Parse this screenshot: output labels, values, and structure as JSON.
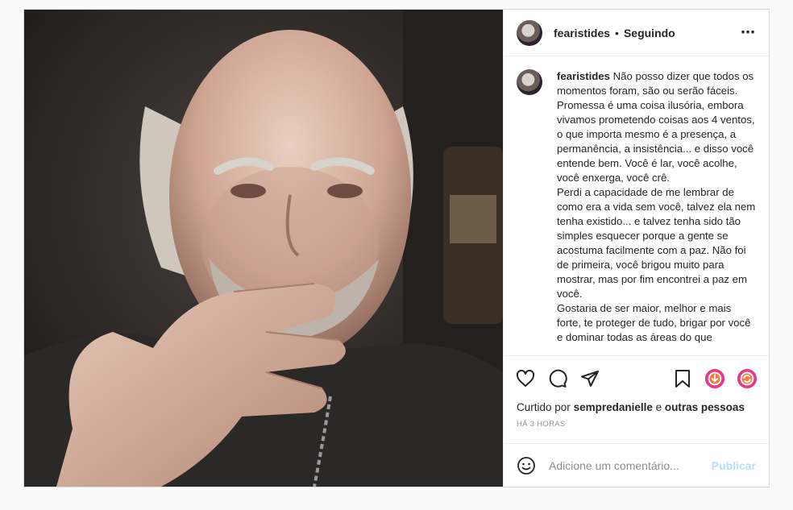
{
  "post": {
    "username": "fearistides",
    "separator": "•",
    "follow_status": "Seguindo",
    "more_icon": "⋯",
    "caption": {
      "username": "fearistides",
      "paragraphs": [
        "Não posso dizer que todos os momentos foram, são ou serão fáceis. Promessa é uma coisa ilusória, embora vivamos prometendo coisas aos 4 ventos, o que importa mesmo é a presença, a permanência, a insistência... e disso você entende bem. Você é lar, você acolhe, você enxerga, você crê.",
        "Perdi a capacidade de me lembrar de como era a vida sem você, talvez ela nem tenha existido... e talvez tenha sido tão simples esquecer porque a gente se acostuma facilmente com a paz. Não foi de primeira, você brigou muito para mostrar, mas por fim encontrei a paz em você.",
        "Gostaria de ser maior, melhor e mais forte, te proteger de tudo, brigar por você e dominar todas as áreas do que"
      ]
    },
    "likes": {
      "prefix": "Curtido por",
      "user": "sempredanielle",
      "middle": "e",
      "others": "outras pessoas"
    },
    "time": "HÁ 3 HORAS",
    "comment_placeholder": "Adicione um comentário...",
    "publish_label": "Publicar"
  },
  "icons": [
    "heart-icon",
    "comment-icon",
    "share-icon",
    "bookmark-icon",
    "download-icon",
    "repost-icon",
    "emoji-icon"
  ],
  "colors": {
    "accent": "#0095f6",
    "publish_disabled": "#b2dffc",
    "muted": "#8e8e8e",
    "ext_orange": "#f57c3a",
    "ext_pink": "#e8388a"
  }
}
